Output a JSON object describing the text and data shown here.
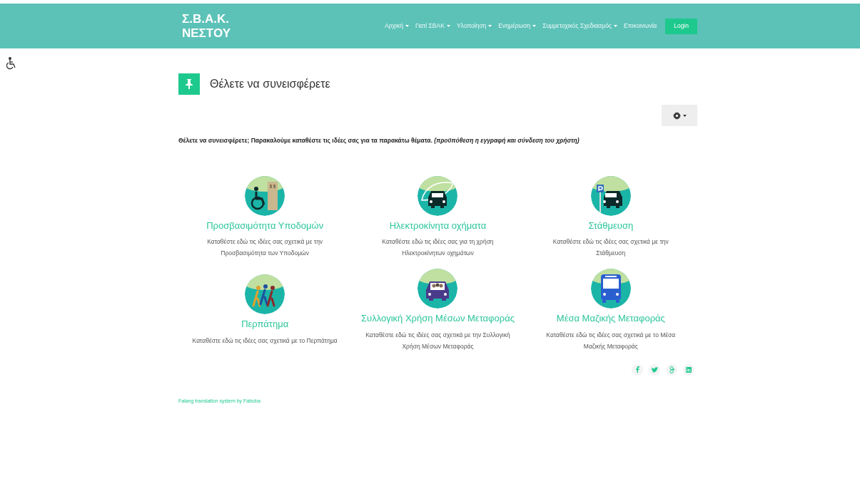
{
  "header": {
    "logo_line_1": "Σ.Β.Α.Κ.",
    "logo_line_2": "ΝΕΣΤΟΥ",
    "nav": [
      {
        "label": "Αρχική",
        "dropdown": true
      },
      {
        "label": "Γιατί ΣΒΑΚ",
        "dropdown": true
      },
      {
        "label": "Υλοποίηση",
        "dropdown": true
      },
      {
        "label": "Ενημέρωση",
        "dropdown": true
      },
      {
        "label": "Συμμετοχικός Σχεδιασμός",
        "dropdown": true
      },
      {
        "label": "Επικοινωνία",
        "dropdown": false
      }
    ],
    "login": "Login"
  },
  "page": {
    "title": "Θέλετε να συνεισφέρετε",
    "intro": "Θέλετε να συνεισφέρετε; Παρακαλούμε καταθέστε τις ιδέες σας για τα παρακάτω θέματα. *(προϋπόθεση η εγγραφή και σύνδεση του χρήστη)*"
  },
  "topics": [
    {
      "title": "Προσβασιμότητα Υποδομών",
      "description": "Καταθέστε εδώ τις ιδέες σας σχετικά με την Προσβασιμότητα των Υποδομών"
    },
    {
      "title": "Ηλεκτροκίνητα οχήματα",
      "description": "Καταθέστε εδώ τις ιδέες σας για τη χρήση Ηλεκτροκίνητων οχημάτων"
    },
    {
      "title": "Στάθμευση",
      "description": "Καταθέστε εδώ τις ιδέες σας σχετικά με την Στάθμευση"
    },
    {
      "title": "Περπάτημα",
      "description": "Καταθέστε εδώ τις ιδέες σας σχετικά με το Περπάτημα"
    },
    {
      "title": "Συλλογική Χρήση Μέσων Μεταφοράς",
      "description": "Καταθέστε εδώ τις ιδέες σας σχετικά με την Συλλογική Χρήση Μέσων Μεταφοράς"
    },
    {
      "title": "Μέσα Μαζικής Μεταφοράς",
      "description": "Καταθέστε εδώ τις ιδέες σας σχετικά με το Μέσα Μαζικής Μεταφοράς"
    }
  ],
  "footer": {
    "credit": "Falang translation system by Faboba"
  }
}
